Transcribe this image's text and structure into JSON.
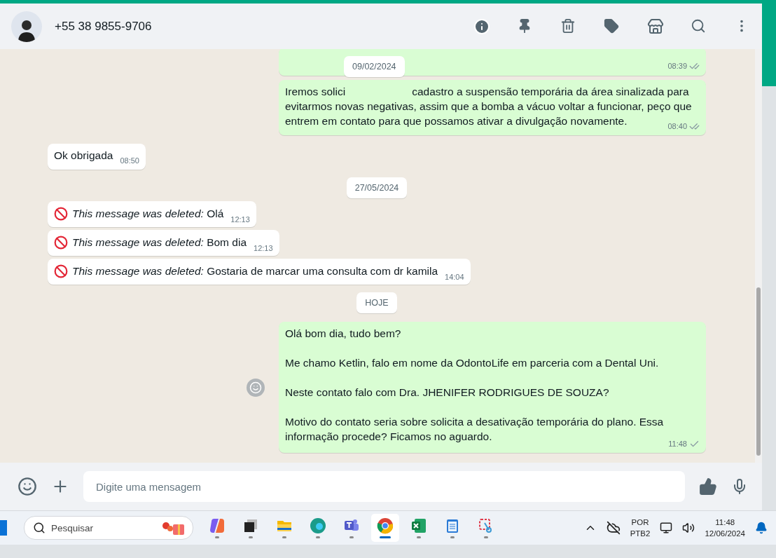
{
  "chat": {
    "contact": "+55 38 9855-9706",
    "sticky_date": "09/02/2024"
  },
  "messages": [
    {
      "kind": "out",
      "partial": true,
      "time": "08:39",
      "delivered": true
    },
    {
      "kind": "out",
      "lead": "Iremos solici",
      "text": "cadastro a suspensão temporária da área sinalizada para evitarmos novas negativas, assim que a bomba a vácuo voltar a funcionar, peço que entrem em contato para que possamos ativar a divulgação novamente.",
      "time": "08:40",
      "delivered": true
    },
    {
      "kind": "in",
      "text": "Ok obrigada",
      "time": "08:50"
    },
    {
      "kind": "date",
      "text": "27/05/2024"
    },
    {
      "kind": "deleted",
      "note": "This message was deleted:",
      "text": "Olá",
      "time": "12:13"
    },
    {
      "kind": "deleted",
      "note": "This message was deleted:",
      "text": "Bom dia",
      "time": "12:13"
    },
    {
      "kind": "deleted",
      "note": "This message was deleted:",
      "text": "Gostaria de marcar uma consulta com dr kamila",
      "time": "14:04"
    },
    {
      "kind": "date",
      "text": "HOJE"
    },
    {
      "kind": "out",
      "paragraphs": [
        "Olá bom dia, tudo bem?",
        "Me chamo Ketlin, falo em nome da OdontoLife em parceria com a Dental Uni.",
        "Neste contato falo com Dra. JHENIFER RODRIGUES DE SOUZA?",
        "Motivo do contato seria sobre solicita a desativação temporária do plano. Essa informação procede? Ficamos no aguardo."
      ],
      "time": "11:48",
      "delivered": false,
      "react": true
    }
  ],
  "composer": {
    "placeholder": "Digite uma mensagem"
  },
  "taskbar": {
    "search_placeholder": "Pesquisar",
    "apps": [
      {
        "kind": "copilot",
        "selected": false
      },
      {
        "kind": "taskview",
        "selected": false
      },
      {
        "kind": "files",
        "selected": false
      },
      {
        "kind": "edge",
        "selected": false
      },
      {
        "kind": "teams",
        "selected": false
      },
      {
        "kind": "chrome",
        "selected": true
      },
      {
        "kind": "excel",
        "selected": false
      },
      {
        "kind": "notepad",
        "selected": false
      },
      {
        "kind": "snip",
        "selected": false
      }
    ],
    "language": "POR",
    "layout": "PTB2",
    "time": "11:48",
    "date": "12/06/2024"
  }
}
